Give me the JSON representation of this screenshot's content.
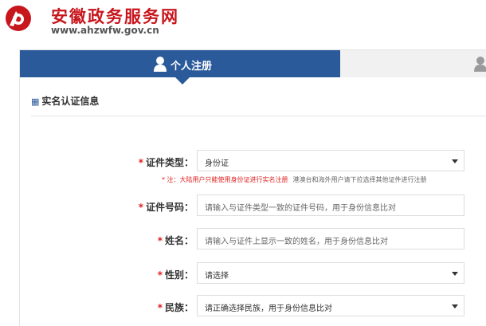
{
  "brand": {
    "title": "安徽政务服务网",
    "url": "www.ahzwfw.gov.cn",
    "logo_color": "#c8161d"
  },
  "tabs": [
    {
      "label": "个人注册",
      "icon": "user-icon",
      "active": true
    },
    {
      "label": "",
      "icon": "user-icon",
      "active": false
    }
  ],
  "section": {
    "title": "实名认证信息",
    "icon": "grid-dots-icon"
  },
  "form": {
    "id_type": {
      "label": "证件类型：",
      "value": "身份证",
      "type": "select"
    },
    "note": {
      "red": "* 注：大陆用户只能使用身份证进行实名注册",
      "gray": "港澳台和海外用户请下拉选择其他证件进行注册"
    },
    "id_number": {
      "label": "证件号码：",
      "placeholder": "请输入与证件类型一致的证件号码，用于身份信息比对"
    },
    "name": {
      "label": "姓名：",
      "placeholder": "请输入与证件上显示一致的姓名，用于身份信息比对"
    },
    "gender": {
      "label": "性别：",
      "value": "请选择",
      "type": "select"
    },
    "ethnicity": {
      "label": "民族：",
      "value": "请正确选择民族，用于身份信息比对",
      "type": "select"
    }
  },
  "colors": {
    "accent": "#2a5a9a",
    "required": "#e02020",
    "brand": "#c8161d"
  }
}
